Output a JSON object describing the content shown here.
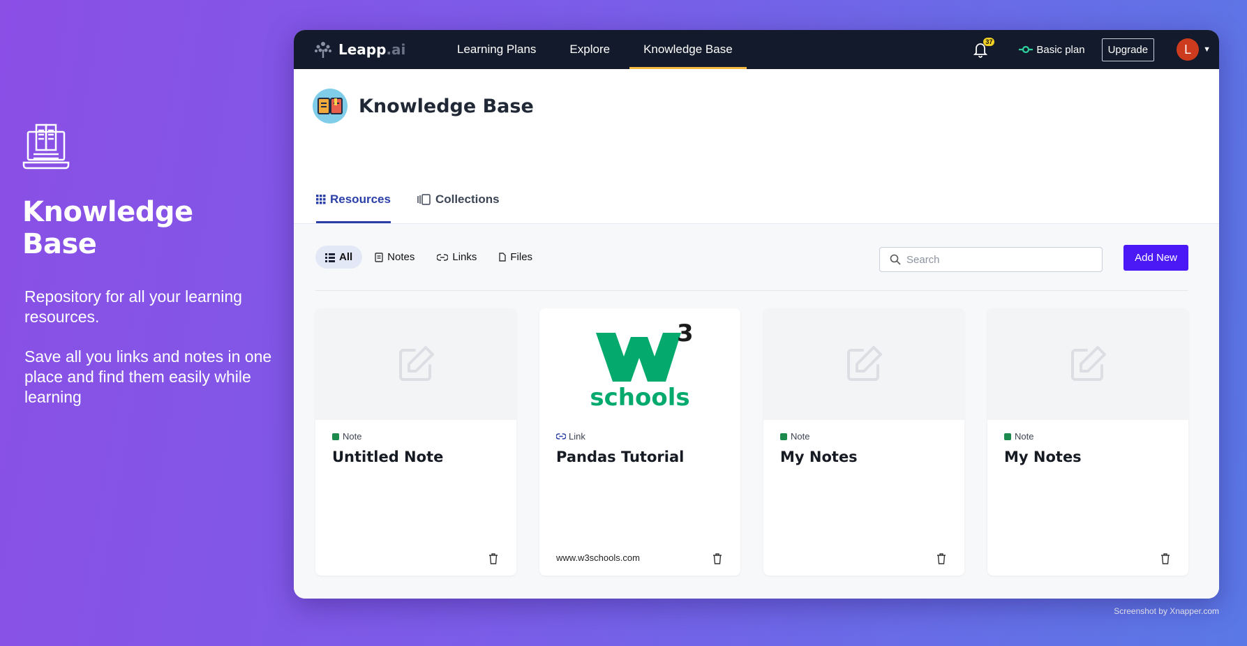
{
  "promo": {
    "title": "Knowledge Base",
    "paragraph1": "Repository for all your learning resources.",
    "paragraph2": "Save all you links and notes in one place and find them easily while learning",
    "icon": "open-book-icon"
  },
  "credit": "Screenshot by Xnapper.com",
  "topbar": {
    "logo_main": "Leapp",
    "logo_suffix": ".ai",
    "nav": [
      {
        "label": "Learning Plans",
        "active": false
      },
      {
        "label": "Explore",
        "active": false
      },
      {
        "label": "Knowledge Base",
        "active": true
      }
    ],
    "notification_count": "37",
    "plan_label": "Basic plan",
    "upgrade_label": "Upgrade",
    "avatar_initial": "L"
  },
  "header": {
    "title": "Knowledge Base",
    "tabs": [
      {
        "label": "Resources",
        "active": true,
        "icon": "grid-icon"
      },
      {
        "label": "Collections",
        "active": false,
        "icon": "collections-icon"
      }
    ]
  },
  "toolbar": {
    "filters": [
      {
        "label": "All",
        "active": true,
        "icon": "list-icon"
      },
      {
        "label": "Notes",
        "active": false,
        "icon": "note-icon"
      },
      {
        "label": "Links",
        "active": false,
        "icon": "link-icon"
      },
      {
        "label": "Files",
        "active": false,
        "icon": "file-icon"
      }
    ],
    "search_placeholder": "Search",
    "add_new_label": "Add New"
  },
  "cards": [
    {
      "type": "Note",
      "title": "Untitled Note",
      "url": ""
    },
    {
      "type": "Link",
      "title": "Pandas Tutorial",
      "url": "www.w3schools.com",
      "logo_sup": "3",
      "logo_word": "schools"
    },
    {
      "type": "Note",
      "title": "My Notes",
      "url": ""
    },
    {
      "type": "Note",
      "title": "My Notes",
      "url": ""
    }
  ],
  "colors": {
    "accent": "#4b19f5",
    "topbar": "#121a2b",
    "active_tab": "#2a3fa8",
    "nav_underline": "#f4b942",
    "w3_green": "#04aa6d"
  }
}
